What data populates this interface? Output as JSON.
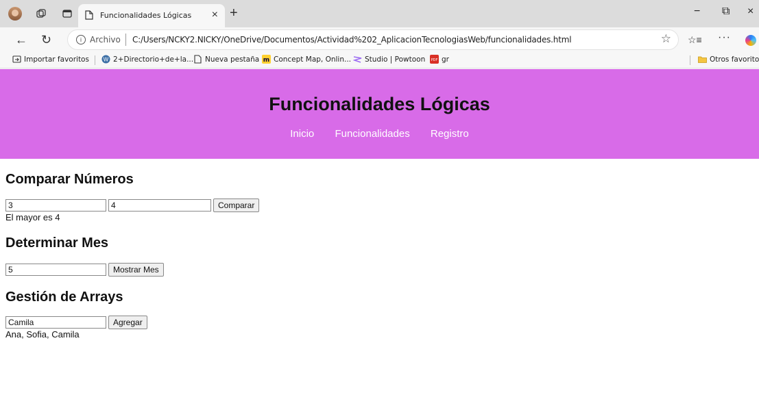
{
  "browser": {
    "tab_title": "Funcionalidades Lógicas",
    "tab_close": "×",
    "new_tab": "+",
    "minimize": "−",
    "maximize": "⧉",
    "close": "×",
    "url_scheme": "Archivo",
    "url": "C:/Users/NCKY2.NICKY/OneDrive/Documentos/Actividad%202_AplicacionTecnologiasWeb/funcionalidades.html",
    "more": "···"
  },
  "bookmarks": {
    "items": [
      {
        "label": "Importar favoritos",
        "icon": "import-icon"
      },
      {
        "label": "2+Directorio+de+la...",
        "icon": "wordpress-icon"
      },
      {
        "label": "Nueva pestaña",
        "icon": "page-icon"
      },
      {
        "label": "Concept Map, Onlin...",
        "icon": "miro-icon"
      },
      {
        "label": "Studio | Powtoon",
        "icon": "powtoon-icon"
      },
      {
        "label": "gr",
        "icon": "pdf-icon"
      }
    ],
    "other": "Otros favoritos"
  },
  "page": {
    "title": "Funcionalidades Lógicas",
    "nav": [
      "Inicio",
      "Funcionalidades",
      "Registro"
    ],
    "compare": {
      "title": "Comparar Números",
      "value1": "3",
      "value2": "4",
      "button": "Comparar",
      "result": "El mayor es 4"
    },
    "month": {
      "title": "Determinar Mes",
      "value": "5",
      "button": "Mostrar Mes"
    },
    "arrays": {
      "title": "Gestión de Arrays",
      "value": "Camila",
      "button": "Agregar",
      "result": "Ana, Sofia, Camila"
    }
  },
  "colors": {
    "header_bg": "#d86be8",
    "nav_link": "#ffffff"
  }
}
